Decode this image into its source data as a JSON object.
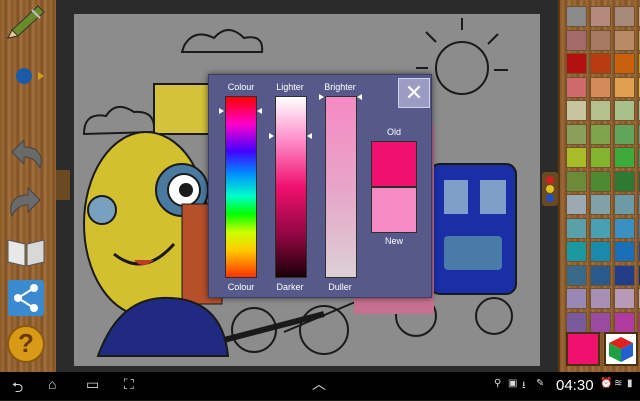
{
  "color_dialog": {
    "colour_label_top": "Colour",
    "lighter_label": "Lighter",
    "brighter_label": "Brighter",
    "colour_label_bottom": "Colour",
    "darker_label": "Darker",
    "duller_label": "Duller",
    "old_label": "Old",
    "new_label": "New",
    "close_icon": "close-icon",
    "old_color": "#f0106e",
    "new_color": "#f58ac4"
  },
  "toolbar": {
    "icons": [
      "pencil-icon",
      "brush-size-icon",
      "undo-icon",
      "redo-icon",
      "book-icon",
      "share-icon",
      "help-icon"
    ],
    "help_label": "?"
  },
  "palette": {
    "colors": [
      [
        "#8a8a8a",
        "#b38a7d",
        "#a78b7a",
        "#c2aa84"
      ],
      [
        "#a26a6a",
        "#a77862",
        "#b88a66",
        "#c4a05e"
      ],
      [
        "#b51010",
        "#b83c10",
        "#c86010",
        "#d89a10"
      ],
      [
        "#cf6a6a",
        "#d48a5a",
        "#e0a050",
        "#e8c03a"
      ],
      [
        "#c8c4a0",
        "#b4c08e",
        "#a8c08a",
        "#9cc29a"
      ],
      [
        "#8aa05a",
        "#7ea44e",
        "#62a45a",
        "#5aa87a"
      ],
      [
        "#a8bc2a",
        "#84b42e",
        "#3eaa3a",
        "#2aa466"
      ],
      [
        "#6c8a3a",
        "#4e8a32",
        "#2e7a32",
        "#1f6a3e"
      ],
      [
        "#9aaab0",
        "#80a0aa",
        "#6c9aa6",
        "#5c90b0"
      ],
      [
        "#5aa0a8",
        "#48a0b4",
        "#3a90c0",
        "#3a7ac6"
      ],
      [
        "#1a9aa0",
        "#1a8aaa",
        "#1a70b8",
        "#1a4ab0"
      ],
      [
        "#3a6a8a",
        "#2a5a8a",
        "#223e8a",
        "#1a2a7a"
      ],
      [
        "#9a88b4",
        "#a890b4",
        "#b89ab8",
        "#c8a4c0"
      ],
      [
        "#7a5a9a",
        "#9a4aa0",
        "#b03aa0",
        "#c02a90"
      ]
    ],
    "selected_color": "#f0106e",
    "cube_icon": "color-cube-icon"
  },
  "statusbar": {
    "time": "04:30",
    "icons": [
      "back-icon",
      "home-icon",
      "recent-apps-icon",
      "screenshot-icon",
      "menu-up-icon",
      "usb-icon",
      "gallery-icon",
      "download-icon",
      "edit-icon",
      "alarm-icon",
      "wifi-icon",
      "battery-icon"
    ]
  }
}
